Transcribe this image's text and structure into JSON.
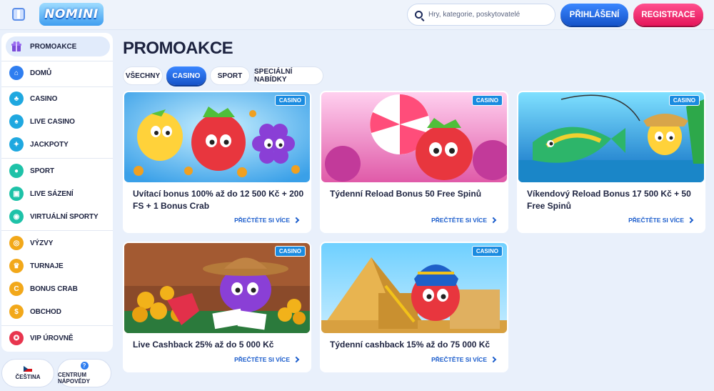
{
  "header": {
    "logo_text": "NOMINI",
    "search_placeholder": "Hry, kategorie, poskytovatelé",
    "login_label": "PŘIHLÁŠENÍ",
    "register_label": "REGISTRACE"
  },
  "sidebar": {
    "items": [
      {
        "label": "PROMOAKCE",
        "icon": "gift-icon",
        "color": "#7b4bd8"
      },
      {
        "label": "DOMŮ",
        "icon": "home-icon",
        "color": "#2f7ef0"
      },
      {
        "label": "CASINO",
        "icon": "cherries-icon",
        "color": "#1fa8e0"
      },
      {
        "label": "LIVE CASINO",
        "icon": "live-cards-icon",
        "color": "#1fa8e0"
      },
      {
        "label": "JACKPOTY",
        "icon": "jackpot-icon",
        "color": "#1fa8e0"
      },
      {
        "label": "SPORT",
        "icon": "football-icon",
        "color": "#1ec2a8"
      },
      {
        "label": "LIVE SÁZENÍ",
        "icon": "live-bet-icon",
        "color": "#1ec2a8"
      },
      {
        "label": "VIRTUÁLNÍ SPORTY",
        "icon": "virtual-sports-icon",
        "color": "#1ec2a8"
      },
      {
        "label": "VÝZVY",
        "icon": "target-icon",
        "color": "#f2a81a"
      },
      {
        "label": "TURNAJE",
        "icon": "trophy-icon",
        "color": "#f2a81a"
      },
      {
        "label": "BONUS CRAB",
        "icon": "crab-icon",
        "color": "#f2a81a"
      },
      {
        "label": "OBCHOD",
        "icon": "shop-icon",
        "color": "#f2a81a"
      },
      {
        "label": "VIP ÚROVNĚ",
        "icon": "vip-icon",
        "color": "#e8354e"
      }
    ],
    "language_label": "ČEŠTINA",
    "help_label": "CENTRUM NÁPOVĚDY"
  },
  "main": {
    "title": "PROMOAKCE",
    "tabs": [
      {
        "label": "VŠECHNY"
      },
      {
        "label": "CASINO"
      },
      {
        "label": "SPORT"
      },
      {
        "label": "SPECIÁLNÍ NABÍDKY"
      }
    ],
    "cards": [
      {
        "badge": "CASINO",
        "title": "Uvítací bonus 100% až do 12 500 Kč + 200 FS + 1 Bonus Crab",
        "link": "PŘEČTĚTE SI VÍCE",
        "image": "fruit-characters-image"
      },
      {
        "badge": "CASINO",
        "title": "Týdenní Reload Bonus 50 Free Spinů",
        "link": "PŘEČTĚTE SI VÍCE",
        "image": "candy-strawberry-image"
      },
      {
        "badge": "CASINO",
        "title": "Víkendový Reload Bonus 17 500 Kč + 50 Free Spinů",
        "link": "PŘEČTĚTE SI VÍCE",
        "image": "fishing-lemon-image"
      },
      {
        "badge": "CASINO",
        "title": "Live Cashback 25% až do 5 000 Kč",
        "link": "PŘEČTĚTE SI VÍCE",
        "image": "cowboy-grape-image"
      },
      {
        "badge": "CASINO",
        "title": "Týdenní cashback 15% až do 75 000 Kč",
        "link": "PŘEČTĚTE SI VÍCE",
        "image": "pharaoh-strawberry-image"
      }
    ]
  }
}
